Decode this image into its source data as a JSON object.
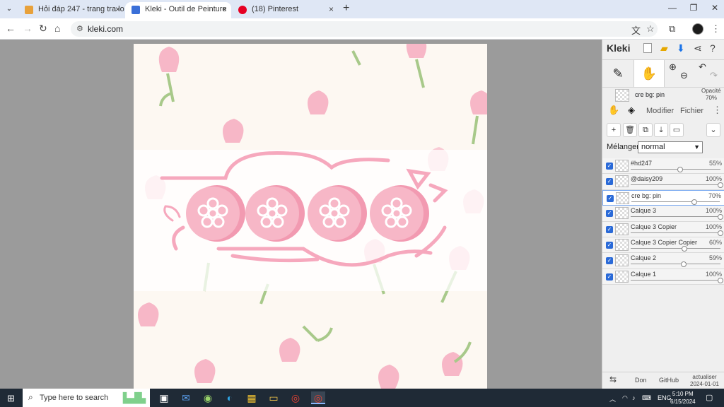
{
  "browser": {
    "tab_search_icon": "chevron-down-icon",
    "tabs": [
      {
        "title": "Hỏi đáp 247 - trang tra loi",
        "favicon_color": "#e8a13a",
        "close": "×"
      },
      {
        "title": "Kleki - Outil de Peinture",
        "favicon_color": "#3a6fd8",
        "close": "×"
      },
      {
        "title": "(18) Pinterest",
        "favicon_color": "#e60023",
        "close": "×"
      }
    ],
    "new_tab": "+",
    "window": {
      "minimize": "—",
      "restore": "❐",
      "close": "✕"
    },
    "url": "kleki.com"
  },
  "app": {
    "brand": "Kleki",
    "current_layer": {
      "name": "cre bg: pin",
      "opacity_label": "Opacité",
      "opacity": "70%"
    },
    "tabs": [
      "Modifier",
      "Fichier"
    ],
    "blend_label": "Mélanger",
    "blend_value": "normal",
    "layers": [
      {
        "name": "#hd247",
        "opacity": "55%",
        "level": 0.55,
        "selected": false
      },
      {
        "name": "@daisy209",
        "opacity": "100%",
        "level": 1.0,
        "selected": false
      },
      {
        "name": "cre bg: pin",
        "opacity": "70%",
        "level": 0.7,
        "selected": true
      },
      {
        "name": "Calque 3",
        "opacity": "100%",
        "level": 1.0,
        "selected": false
      },
      {
        "name": "Calque 3 Copier",
        "opacity": "100%",
        "level": 1.0,
        "selected": false
      },
      {
        "name": "Calque 3 Copier Copier",
        "opacity": "60%",
        "level": 0.6,
        "selected": false
      },
      {
        "name": "Calque 2",
        "opacity": "59%",
        "level": 0.59,
        "selected": false
      },
      {
        "name": "Calque 1",
        "opacity": "100%",
        "level": 1.0,
        "selected": false
      }
    ],
    "footer": {
      "don": "Don",
      "github": "GitHub",
      "update_label": "actualiser",
      "update_date": "2024-01-01"
    }
  },
  "taskbar": {
    "search_placeholder": "Type here to search",
    "lang": "ENG",
    "time": "5:10 PM",
    "date": "6/15/2024"
  },
  "colors": {
    "pink": "#f7b7c7",
    "pink_dark": "#f29ab1",
    "leaf": "#a8c98a",
    "canvas_bg": "#fdf8f2"
  }
}
